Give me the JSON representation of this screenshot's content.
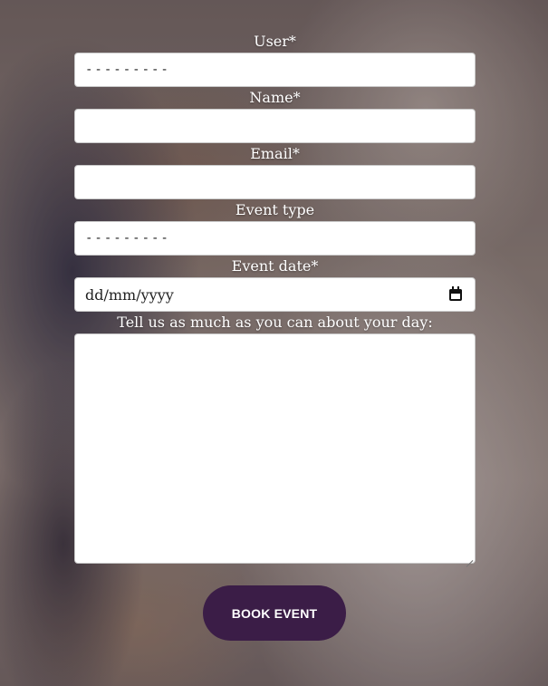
{
  "form": {
    "user": {
      "label": "User*",
      "value": "---------"
    },
    "name": {
      "label": "Name*",
      "value": ""
    },
    "email": {
      "label": "Email*",
      "value": ""
    },
    "event_type": {
      "label": "Event type",
      "value": "---------"
    },
    "event_date": {
      "label": "Event date*",
      "placeholder": "dd/mm/yyyy",
      "icon": "calendar-icon"
    },
    "details": {
      "label": "Tell us as much as you can about your day:",
      "value": ""
    }
  },
  "actions": {
    "submit_label": "BOOK EVENT"
  },
  "colors": {
    "button_bg": "#3b1d47",
    "label_text": "#ffffff",
    "field_bg": "#ffffff"
  }
}
